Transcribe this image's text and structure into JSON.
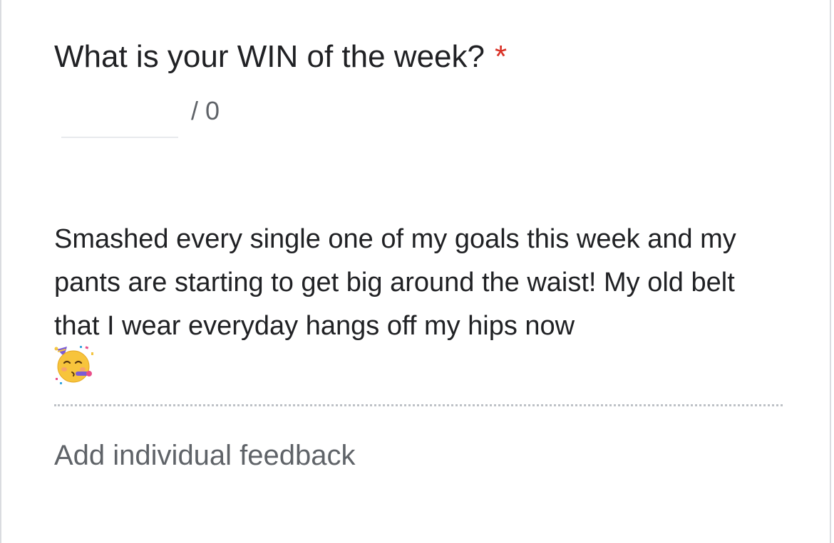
{
  "question": {
    "title": "What is your WIN of the week?",
    "required_marker": "*"
  },
  "points": {
    "value": "",
    "total_label": "/ 0"
  },
  "answer": {
    "text": "Smashed every single one of my goals this week and my pants are starting to get big around the waist! My old belt that I wear everyday hangs off my hips now",
    "emoji": "partying-face-icon"
  },
  "feedback": {
    "add_label": "Add individual feedback"
  },
  "colors": {
    "required_star": "#d93025",
    "text_primary": "#202124",
    "text_secondary": "#5f6368",
    "divider": "#bdc1c6"
  }
}
